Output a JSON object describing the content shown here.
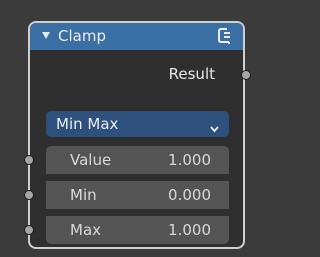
{
  "node": {
    "title": "Clamp",
    "header_color": "#3a6fa3",
    "icon": "node-type-icon"
  },
  "output": {
    "label": "Result",
    "socket_color": "#a6a6a6"
  },
  "clamp_type": {
    "selected": "Min Max",
    "color": "#2d507c"
  },
  "inputs": [
    {
      "label": "Value",
      "value": "1.000"
    },
    {
      "label": "Min",
      "value": "0.000"
    },
    {
      "label": "Max",
      "value": "1.000"
    }
  ]
}
